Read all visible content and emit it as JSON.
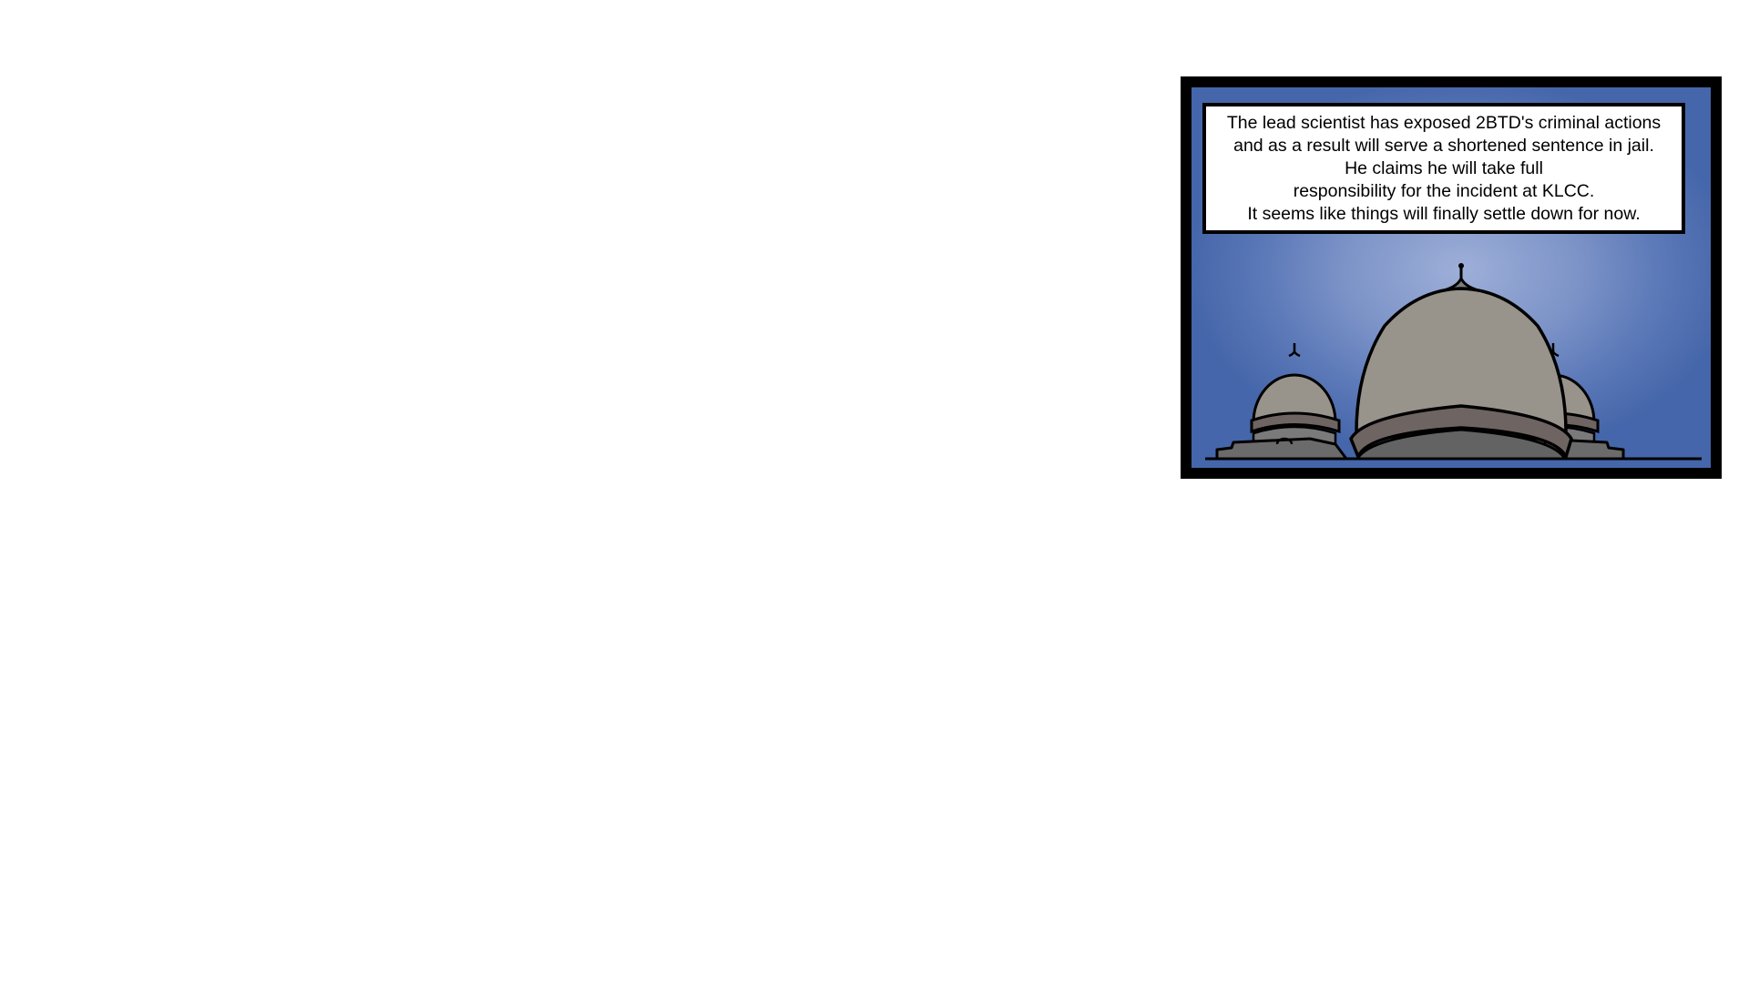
{
  "panel": {
    "colors": {
      "border": "#000000",
      "sky_inner": "#9eafd8",
      "sky_outer": "#4566aa",
      "dome": "#98948c",
      "dome_band": "#6e6462",
      "building_base": "#6b6b6b"
    },
    "scene": [
      "central-dome",
      "left-dome",
      "right-dome",
      "dome-finial"
    ],
    "caption": {
      "lines": [
        "The lead scientist has exposed 2BTD's criminal actions",
        "and as a result will serve a shortened sentence in jail.",
        "He claims he will take full",
        "responsibility for the incident at KLCC.",
        "It seems like things will finally settle down for now."
      ]
    }
  }
}
